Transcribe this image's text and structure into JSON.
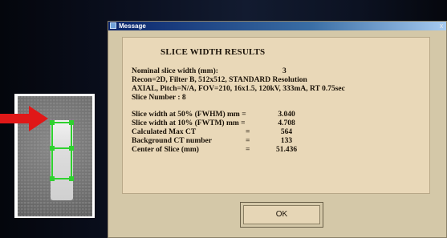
{
  "dialog": {
    "title": "Message",
    "close_glyph": "x",
    "ok_label": "OK"
  },
  "results": {
    "heading": "SLICE WIDTH RESULTS",
    "nominal_label": "Nominal slice width (mm):",
    "nominal_value": "3",
    "recon_line": "Recon=2D, Filter B, 512x512, STANDARD Resolution",
    "axial_line": "AXIAL, Pitch=N/A, FOV=210, 16x1.5, 120kV, 333mA, RT 0.75sec",
    "slice_number_line": "Slice Number : 8",
    "rows": [
      {
        "label": "Slice width at 50%  (FWHM) mm =",
        "eq": "",
        "value": "3.040"
      },
      {
        "label": "Slice width at 10%  (FWTM) mm =",
        "eq": "",
        "value": "4.708"
      },
      {
        "label": "Calculated Max CT",
        "eq": "=",
        "value": "564"
      },
      {
        "label": "Background CT number",
        "eq": "=",
        "value": "133"
      },
      {
        "label": "Center of Slice (mm)",
        "eq": "=",
        "value": "51.436"
      }
    ]
  },
  "icons": {
    "arrow": "red-arrow-icon",
    "dialog_icon": "message-window-icon"
  },
  "colors": {
    "dialog_bg": "#d4c8a8",
    "panel_bg": "#e9d8b8",
    "roi": "#2fd12f",
    "arrow": "#e01818"
  }
}
